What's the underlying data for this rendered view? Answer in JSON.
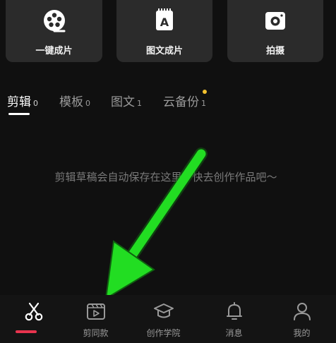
{
  "quick_actions": [
    {
      "label": "一键成片",
      "icon": "film-reel-icon"
    },
    {
      "label": "图文成片",
      "icon": "document-a-icon"
    },
    {
      "label": "拍摄",
      "icon": "camera-icon"
    }
  ],
  "tabs": [
    {
      "label": "剪辑",
      "count": "0",
      "active": true
    },
    {
      "label": "模板",
      "count": "0"
    },
    {
      "label": "图文",
      "count": "1"
    },
    {
      "label": "云备份",
      "count": "1",
      "badge": true
    }
  ],
  "empty_message": "剪辑草稿会自动保存在这里，快去创作作品吧～",
  "bottom_nav": [
    {
      "label": "",
      "icon": "scissors-icon",
      "active": true
    },
    {
      "label": "剪同款",
      "icon": "video-template-icon"
    },
    {
      "label": "创作学院",
      "icon": "graduation-cap-icon"
    },
    {
      "label": "消息",
      "icon": "bell-icon"
    },
    {
      "label": "我的",
      "icon": "user-icon"
    }
  ],
  "colors": {
    "accent": "#e8344e",
    "arrow": "#22dd22",
    "badge": "#f2c12e"
  }
}
